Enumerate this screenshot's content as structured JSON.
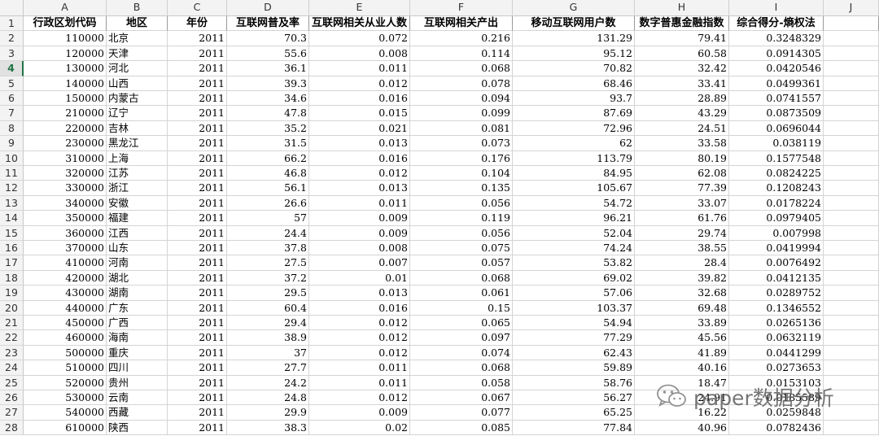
{
  "columns": [
    "A",
    "B",
    "C",
    "D",
    "E",
    "F",
    "G",
    "H",
    "I",
    "J"
  ],
  "header_row": {
    "row": "1",
    "cells": [
      "行政区划代码",
      "地区",
      "年份",
      "互联网普及率",
      "互联网相关从业人数",
      "互联网相关产出",
      "移动互联网用户数",
      "数字普惠金融指数",
      "综合得分-熵权法",
      ""
    ]
  },
  "rows": [
    {
      "row": "2",
      "cells": [
        "110000",
        "北京",
        "2011",
        "70.3",
        "0.072",
        "0.216",
        "131.29",
        "79.41",
        "0.3248329",
        ""
      ]
    },
    {
      "row": "3",
      "cells": [
        "120000",
        "天津",
        "2011",
        "55.6",
        "0.008",
        "0.114",
        "95.12",
        "60.58",
        "0.0914305",
        ""
      ]
    },
    {
      "row": "4",
      "cells": [
        "130000",
        "河北",
        "2011",
        "36.1",
        "0.011",
        "0.068",
        "70.82",
        "32.42",
        "0.0420546",
        ""
      ]
    },
    {
      "row": "5",
      "cells": [
        "140000",
        "山西",
        "2011",
        "39.3",
        "0.012",
        "0.078",
        "68.46",
        "33.41",
        "0.0499361",
        ""
      ]
    },
    {
      "row": "6",
      "cells": [
        "150000",
        "内蒙古",
        "2011",
        "34.6",
        "0.016",
        "0.094",
        "93.7",
        "28.89",
        "0.0741557",
        ""
      ]
    },
    {
      "row": "7",
      "cells": [
        "210000",
        "辽宁",
        "2011",
        "47.8",
        "0.015",
        "0.099",
        "87.69",
        "43.29",
        "0.0873509",
        ""
      ]
    },
    {
      "row": "8",
      "cells": [
        "220000",
        "吉林",
        "2011",
        "35.2",
        "0.021",
        "0.081",
        "72.96",
        "24.51",
        "0.0696044",
        ""
      ]
    },
    {
      "row": "9",
      "cells": [
        "230000",
        "黑龙江",
        "2011",
        "31.5",
        "0.013",
        "0.073",
        "62",
        "33.58",
        "0.038119",
        ""
      ]
    },
    {
      "row": "10",
      "cells": [
        "310000",
        "上海",
        "2011",
        "66.2",
        "0.016",
        "0.176",
        "113.79",
        "80.19",
        "0.1577548",
        ""
      ]
    },
    {
      "row": "11",
      "cells": [
        "320000",
        "江苏",
        "2011",
        "46.8",
        "0.012",
        "0.104",
        "84.95",
        "62.08",
        "0.0824225",
        ""
      ]
    },
    {
      "row": "12",
      "cells": [
        "330000",
        "浙江",
        "2011",
        "56.1",
        "0.013",
        "0.135",
        "105.67",
        "77.39",
        "0.1208243",
        ""
      ]
    },
    {
      "row": "13",
      "cells": [
        "340000",
        "安徽",
        "2011",
        "26.6",
        "0.011",
        "0.056",
        "54.72",
        "33.07",
        "0.0178224",
        ""
      ]
    },
    {
      "row": "14",
      "cells": [
        "350000",
        "福建",
        "2011",
        "57",
        "0.009",
        "0.119",
        "96.21",
        "61.76",
        "0.0979405",
        ""
      ]
    },
    {
      "row": "15",
      "cells": [
        "360000",
        "江西",
        "2011",
        "24.4",
        "0.009",
        "0.056",
        "52.04",
        "29.74",
        "0.007998",
        ""
      ]
    },
    {
      "row": "16",
      "cells": [
        "370000",
        "山东",
        "2011",
        "37.8",
        "0.008",
        "0.075",
        "74.24",
        "38.55",
        "0.0419994",
        ""
      ]
    },
    {
      "row": "17",
      "cells": [
        "410000",
        "河南",
        "2011",
        "27.5",
        "0.007",
        "0.057",
        "53.82",
        "28.4",
        "0.0076492",
        ""
      ]
    },
    {
      "row": "18",
      "cells": [
        "420000",
        "湖北",
        "2011",
        "37.2",
        "0.01",
        "0.068",
        "69.02",
        "39.82",
        "0.0412135",
        ""
      ]
    },
    {
      "row": "19",
      "cells": [
        "430000",
        "湖南",
        "2011",
        "29.5",
        "0.013",
        "0.061",
        "57.06",
        "32.68",
        "0.0289752",
        ""
      ]
    },
    {
      "row": "20",
      "cells": [
        "440000",
        "广东",
        "2011",
        "60.4",
        "0.016",
        "0.15",
        "103.37",
        "69.48",
        "0.1346552",
        ""
      ]
    },
    {
      "row": "21",
      "cells": [
        "450000",
        "广西",
        "2011",
        "29.4",
        "0.012",
        "0.065",
        "54.94",
        "33.89",
        "0.0265136",
        ""
      ]
    },
    {
      "row": "22",
      "cells": [
        "460000",
        "海南",
        "2011",
        "38.9",
        "0.012",
        "0.097",
        "77.29",
        "45.56",
        "0.0632119",
        ""
      ]
    },
    {
      "row": "23",
      "cells": [
        "500000",
        "重庆",
        "2011",
        "37",
        "0.012",
        "0.074",
        "62.43",
        "41.89",
        "0.0441299",
        ""
      ]
    },
    {
      "row": "24",
      "cells": [
        "510000",
        "四川",
        "2011",
        "27.7",
        "0.011",
        "0.068",
        "59.89",
        "40.16",
        "0.0273653",
        ""
      ]
    },
    {
      "row": "25",
      "cells": [
        "520000",
        "贵州",
        "2011",
        "24.2",
        "0.011",
        "0.058",
        "58.76",
        "18.47",
        "0.0153103",
        ""
      ]
    },
    {
      "row": "26",
      "cells": [
        "530000",
        "云南",
        "2011",
        "24.8",
        "0.012",
        "0.067",
        "56.27",
        "24.91",
        "0.0185589",
        ""
      ]
    },
    {
      "row": "27",
      "cells": [
        "540000",
        "西藏",
        "2011",
        "29.9",
        "0.009",
        "0.077",
        "65.25",
        "16.22",
        "0.0259848",
        ""
      ]
    },
    {
      "row": "28",
      "cells": [
        "610000",
        "陕西",
        "2011",
        "38.3",
        "0.02",
        "0.085",
        "77.84",
        "40.96",
        "0.0782436",
        ""
      ]
    }
  ],
  "active_row": "4",
  "watermark": {
    "text": "paper数据分析",
    "icon": "wechat-icon"
  },
  "colors": {
    "accent": "#217346",
    "header_bg": "#f3f3f3",
    "gridline": "#d4d4d4"
  }
}
